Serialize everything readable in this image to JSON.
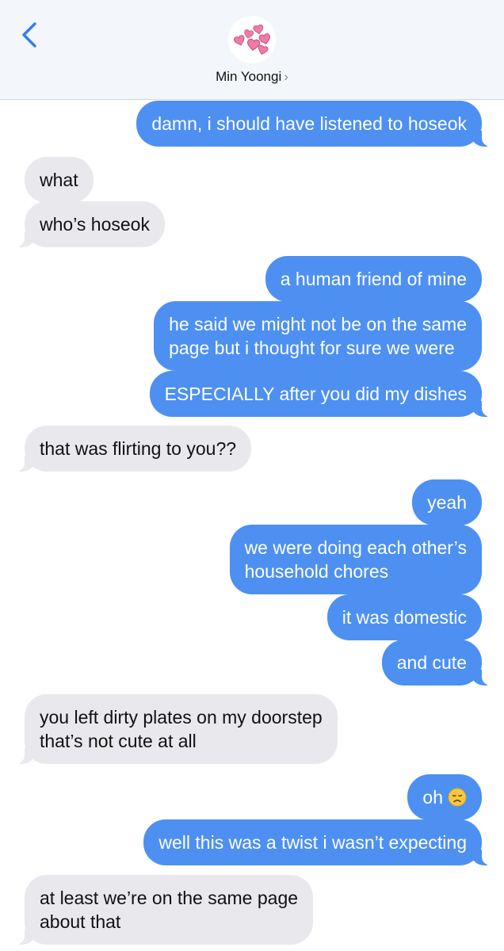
{
  "header": {
    "back_icon": "chevron-left-icon",
    "avatar_icon": "pink-hearts-icon",
    "contact_name": "Min Yoongi",
    "chevron": "›",
    "accent_color": "#2f7cf6"
  },
  "colors": {
    "outgoing_bubble": "#4d90f2",
    "incoming_bubble": "#e9e9ed"
  },
  "messages": [
    {
      "direction": "outgoing",
      "text": "damn, i should have listened to hoseok"
    },
    {
      "direction": "incoming",
      "text": "what"
    },
    {
      "direction": "incoming",
      "text": "who’s hoseok"
    },
    {
      "direction": "outgoing",
      "text": "a human friend of mine"
    },
    {
      "direction": "outgoing",
      "lines": [
        "he said we might not be on the same",
        "page but i thought for sure we were"
      ]
    },
    {
      "direction": "outgoing",
      "text": "ESPECIALLY after you did my dishes"
    },
    {
      "direction": "incoming",
      "text": "that was flirting to you??"
    },
    {
      "direction": "outgoing",
      "text": "yeah"
    },
    {
      "direction": "outgoing",
      "lines": [
        "we were doing each other’s",
        "household chores"
      ]
    },
    {
      "direction": "outgoing",
      "text": "it was domestic"
    },
    {
      "direction": "outgoing",
      "text": "and cute"
    },
    {
      "direction": "incoming",
      "lines": [
        "you left dirty plates on my doorstep",
        "that’s not cute at all"
      ]
    },
    {
      "direction": "outgoing",
      "text": "oh",
      "emoji": "disappointed-face-icon"
    },
    {
      "direction": "outgoing",
      "text": "well this was a twist i wasn’t expecting"
    },
    {
      "direction": "incoming",
      "lines": [
        "at least we’re on the same page",
        "about that"
      ]
    }
  ]
}
